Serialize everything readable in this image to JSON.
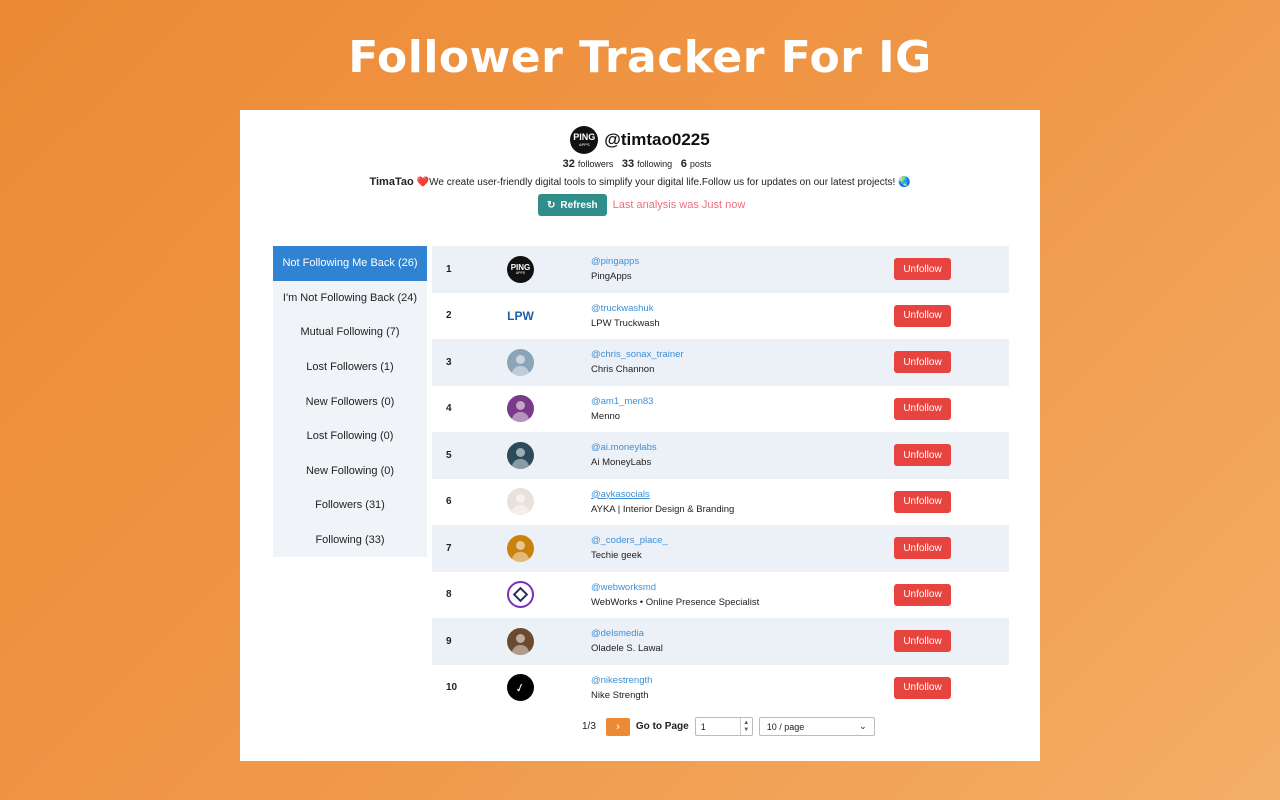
{
  "hero": {
    "title": "Follower Tracker For IG"
  },
  "profile": {
    "avatar_text": "PING",
    "avatar_sub": "APPS",
    "handle": "@timtao0225",
    "followers_count": "32",
    "followers_label": "followers",
    "following_count": "33",
    "following_label": "following",
    "posts_count": "6",
    "posts_label": "posts",
    "name": "TimaTao",
    "bio": "We create user-friendly digital tools to simplify your digital life.Follow us for updates on our latest projects! 🌏",
    "bio_heart": "❤️"
  },
  "toolbar": {
    "refresh_icon": "refresh-icon",
    "refresh_label": "Refresh",
    "last_analysis": "Last analysis was Just now"
  },
  "sidebar": {
    "items": [
      {
        "label": "Not Following Me Back (26)",
        "active": true
      },
      {
        "label": "I'm Not Following Back (24)",
        "active": false
      },
      {
        "label": "Mutual Following (7)",
        "active": false
      },
      {
        "label": "Lost Followers (1)",
        "active": false
      },
      {
        "label": "New Followers (0)",
        "active": false
      },
      {
        "label": "Lost Following (0)",
        "active": false
      },
      {
        "label": "New Following (0)",
        "active": false
      },
      {
        "label": "Followers (31)",
        "active": false
      },
      {
        "label": "Following (33)",
        "active": false
      }
    ]
  },
  "table": {
    "unfollow_label": "Unfollow",
    "rows": [
      {
        "index": "1",
        "username": "@pingapps",
        "full_name": "PingApps",
        "avatar": "pingapps-logo",
        "avatar_text": "PING",
        "avatar_sub": "APPS",
        "avatar_color": "#111111"
      },
      {
        "index": "2",
        "username": "@truckwashuk",
        "full_name": "LPW Truckwash",
        "avatar": "lpw-logo",
        "avatar_text": "LPW",
        "avatar_sub": "",
        "avatar_color": "#ffffff"
      },
      {
        "index": "3",
        "username": "@chris_sonax_trainer",
        "full_name": "Chris Channon",
        "avatar": "user-photo",
        "avatar_text": "",
        "avatar_sub": "",
        "avatar_color": "#8aa4b8"
      },
      {
        "index": "4",
        "username": "@am1_men83",
        "full_name": "Menno",
        "avatar": "user-photo",
        "avatar_text": "",
        "avatar_sub": "",
        "avatar_color": "#7a3a8a"
      },
      {
        "index": "5",
        "username": "@ai.moneylabs",
        "full_name": "Ai MoneyLabs",
        "avatar": "user-photo",
        "avatar_text": "",
        "avatar_sub": "",
        "avatar_color": "#2b4a5a"
      },
      {
        "index": "6",
        "username": "@aykasocials",
        "full_name": "AYKA | Interior Design & Branding",
        "avatar": "user-photo",
        "avatar_text": "",
        "avatar_sub": "",
        "avatar_color": "#e9e2dc"
      },
      {
        "index": "7",
        "username": "@_coders_place_",
        "full_name": "Techie geek",
        "avatar": "user-photo",
        "avatar_text": "",
        "avatar_sub": "",
        "avatar_color": "#c9820c"
      },
      {
        "index": "8",
        "username": "@webworksmd",
        "full_name": "WebWorks • Online Presence Specialist",
        "avatar": "webworks-logo",
        "avatar_text": "",
        "avatar_sub": "",
        "avatar_color": "#7b2fbf"
      },
      {
        "index": "9",
        "username": "@delsmedia",
        "full_name": "Oladele S. Lawal",
        "avatar": "user-photo",
        "avatar_text": "",
        "avatar_sub": "",
        "avatar_color": "#6b4a2e"
      },
      {
        "index": "10",
        "username": "@nikestrength",
        "full_name": "Nike Strength",
        "avatar": "nike-logo",
        "avatar_text": "",
        "avatar_sub": "",
        "avatar_color": "#000000"
      }
    ]
  },
  "pagination": {
    "page_info": "1/3",
    "next_icon": "chevron-right-icon",
    "goto_label": "Go to Page",
    "page_value": "1",
    "per_page": "10 / page"
  },
  "colors": {
    "accent": "#ec8a35",
    "active_tab": "#2f83d2",
    "refresh": "#2f8d8a",
    "unfollow": "#e8443f",
    "link": "#3e8fd6"
  }
}
